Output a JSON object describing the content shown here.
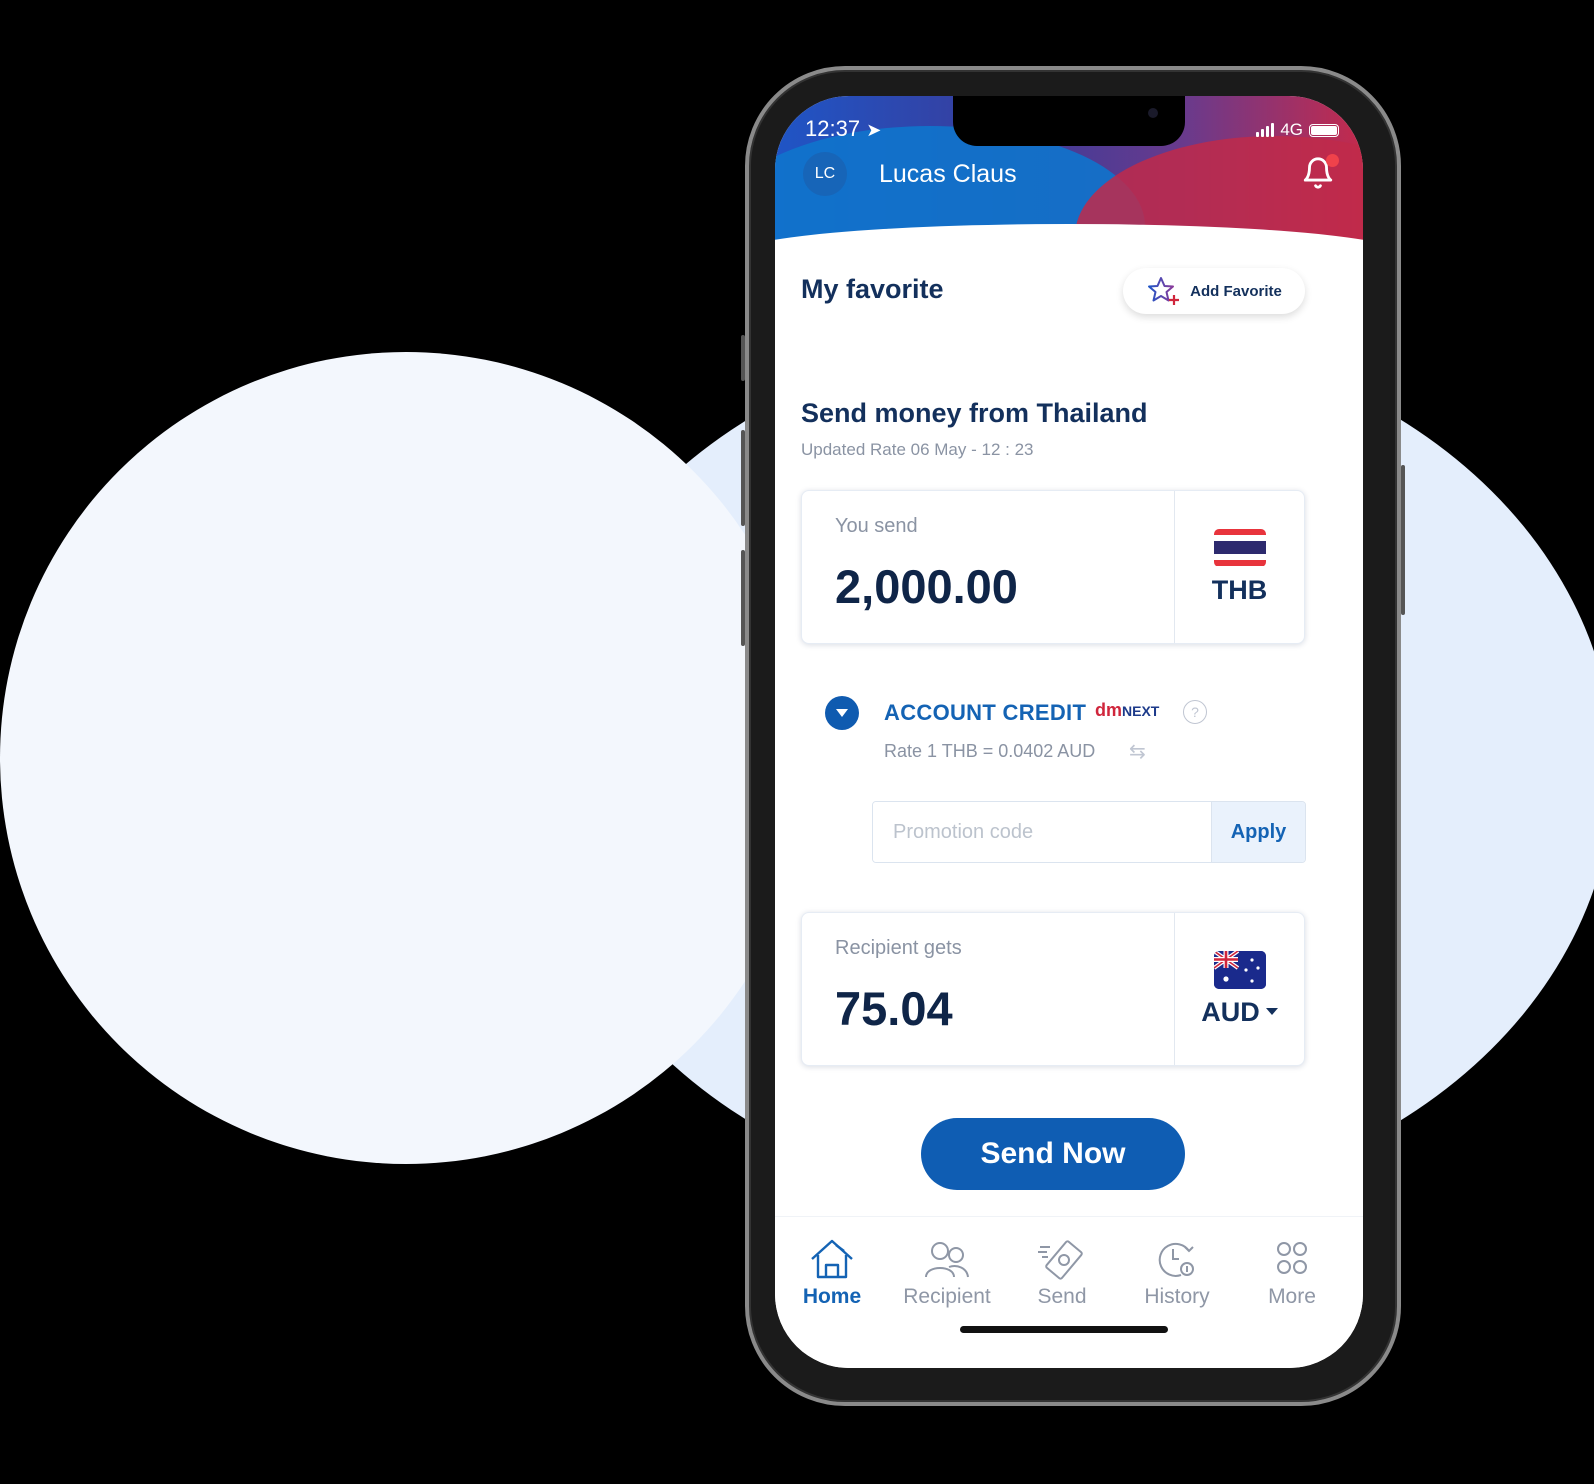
{
  "status_bar": {
    "time": "12:37",
    "network": "4G"
  },
  "header": {
    "avatar_initials": "LC",
    "user_name": "Lucas Claus",
    "has_notification": true
  },
  "favorite": {
    "title": "My favorite",
    "add_label": "Add Favorite"
  },
  "send_section": {
    "title": "Send money from Thailand",
    "updated_rate": "Updated Rate 06 May - 12 : 23"
  },
  "you_send": {
    "label": "You send",
    "amount": "2,000.00",
    "currency": "THB"
  },
  "account_credit": {
    "label": "ACCOUNT CREDIT",
    "partner_logo": "dmNEXT",
    "help": "?",
    "rate": "Rate 1 THB = 0.0402 AUD"
  },
  "promo": {
    "placeholder": "Promotion code",
    "value": "",
    "apply_label": "Apply"
  },
  "recipient_gets": {
    "label": "Recipient gets",
    "amount": "75.04",
    "currency": "AUD"
  },
  "send_button": {
    "label": "Send Now"
  },
  "tabbar": {
    "items": [
      {
        "label": "Home",
        "icon": "home-icon",
        "active": true
      },
      {
        "label": "Recipient",
        "icon": "recipient-icon",
        "active": false
      },
      {
        "label": "Send",
        "icon": "send-money-icon",
        "active": false
      },
      {
        "label": "History",
        "icon": "history-icon",
        "active": false
      },
      {
        "label": "More",
        "icon": "more-grid-icon",
        "active": false
      }
    ]
  },
  "colors": {
    "primary": "#0f5db3",
    "text_dark": "#13305c",
    "muted": "#8a93a3",
    "header_blue": "#1f55c6",
    "header_red": "#c42a4c"
  }
}
